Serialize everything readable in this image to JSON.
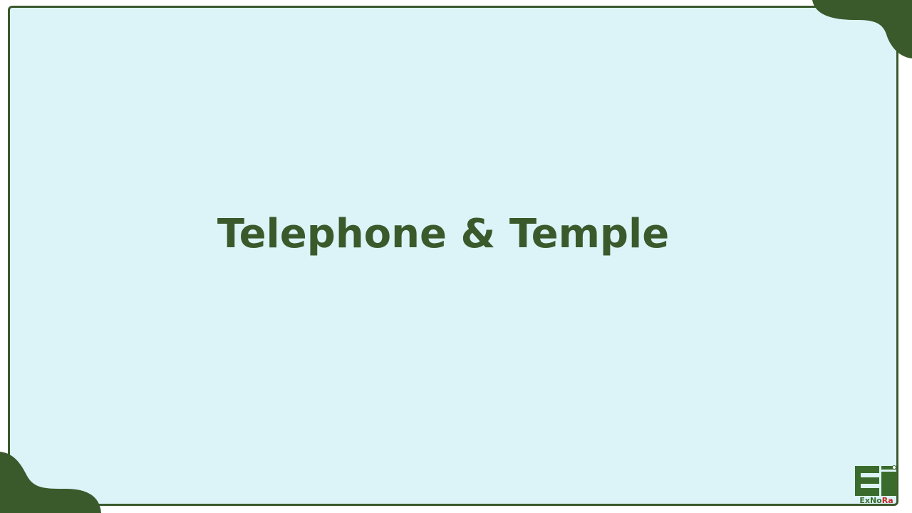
{
  "slide": {
    "title": "Telephone & Temple"
  },
  "logo": {
    "text_ex": "Ex",
    "text_no": "No",
    "text_ra": "Ra"
  },
  "colors": {
    "border": "#3a5a2c",
    "background": "#dcf4f7",
    "title": "#3a5a2c",
    "logo_green": "#3a6b2c",
    "logo_red": "#c62828"
  }
}
